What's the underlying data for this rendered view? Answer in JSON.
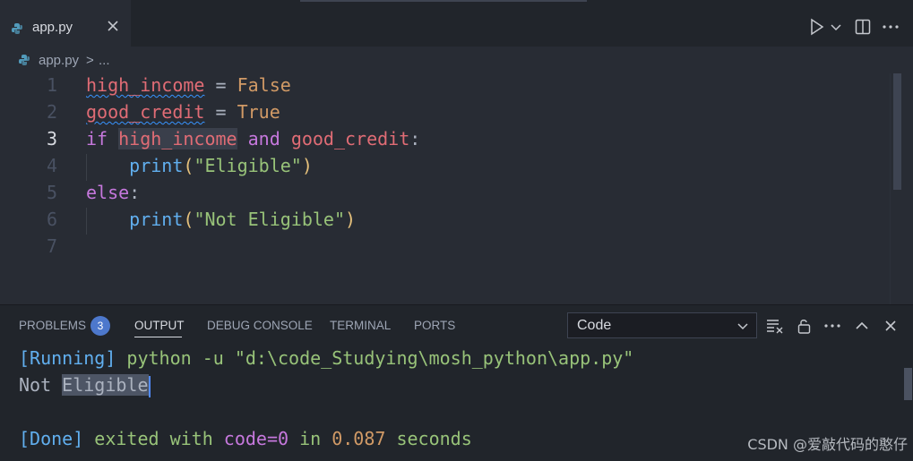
{
  "tabs": [
    {
      "label": "app.py",
      "icon": "python-file-icon",
      "active": true
    }
  ],
  "breadcrumb": {
    "file": "app.py",
    "separator": ">",
    "more": "..."
  },
  "editor": {
    "active_line": 3,
    "lines": [
      {
        "number": "1"
      },
      {
        "number": "2"
      },
      {
        "number": "3"
      },
      {
        "number": "4"
      },
      {
        "number": "5"
      },
      {
        "number": "6"
      },
      {
        "number": "7"
      }
    ],
    "tokens": {
      "l1_var": "high_income",
      "l1_op": " = ",
      "l1_val": "False",
      "l2_var": "good_credit",
      "l2_op": " = ",
      "l2_val": "True",
      "l3_if": "if",
      "l3_var1": "high_income",
      "l3_and": "and",
      "l3_var2": "good_credit",
      "l3_colon": ":",
      "l4_fn": "print",
      "l4_open": "(",
      "l4_str": "\"Eligible\"",
      "l4_close": ")",
      "l5_else": "else",
      "l5_colon": ":",
      "l6_fn": "print",
      "l6_open": "(",
      "l6_str": "\"Not Eligible\"",
      "l6_close": ")"
    }
  },
  "panel": {
    "tabs": [
      {
        "label": "PROBLEMS",
        "badge": "3"
      },
      {
        "label": "OUTPUT",
        "active": true
      },
      {
        "label": "DEBUG CONSOLE"
      },
      {
        "label": "TERMINAL"
      },
      {
        "label": "PORTS"
      }
    ],
    "channel_select": {
      "value": "Code"
    }
  },
  "output": {
    "running_tag": "[Running]",
    "command": " python -u \"d:\\code_Studying\\mosh_python\\app.py\"",
    "result_plain": "Not ",
    "result_selected": "Eligible",
    "done_tag": "[Done]",
    "done_exited": " exited with ",
    "done_code": "code=0",
    "done_in": " in ",
    "done_time": "0.087",
    "done_seconds": " seconds"
  },
  "watermark": "CSDN @爱敲代码的憨仔",
  "colors": {
    "accent": "#4d78cc",
    "background": "#282c34",
    "panel": "#21252b"
  }
}
